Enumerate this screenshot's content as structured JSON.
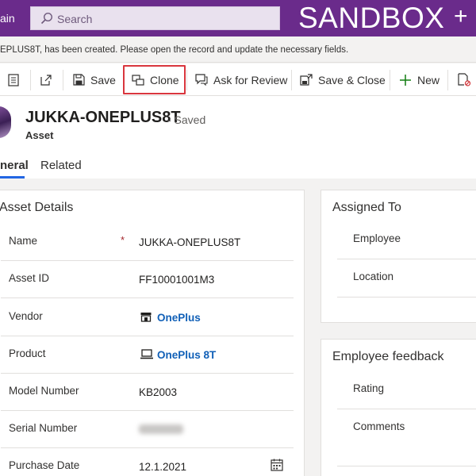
{
  "topbar": {
    "app_name": "ain",
    "search_placeholder": "Search",
    "environment": "SANDBOX",
    "accent": "#6a2b8b"
  },
  "notification": {
    "text": "EPLUS8T, has been created. Please open the record and update the necessary fields."
  },
  "commands": {
    "save": "Save",
    "clone": "Clone",
    "ask_for_review": "Ask for Review",
    "save_close": "Save & Close",
    "new": "New"
  },
  "record": {
    "title": "JUKKA-ONEPLUS8T",
    "status": "- Saved",
    "entity": "Asset"
  },
  "tabs": [
    "neral",
    "Related"
  ],
  "asset_details": {
    "title": "Asset Details",
    "fields": [
      {
        "label": "Name",
        "value": "JUKKA-ONEPLUS8T",
        "required": "*"
      },
      {
        "label": "Asset ID",
        "value": "FF10001001M3"
      },
      {
        "label": "Vendor",
        "value": "OnePlus"
      },
      {
        "label": "Product",
        "value": "OnePlus 8T"
      },
      {
        "label": "Model Number",
        "value": "KB2003"
      },
      {
        "label": "Serial Number",
        "value": ""
      },
      {
        "label": "Purchase Date",
        "value": "12.1.2021"
      }
    ]
  },
  "assigned_to": {
    "title": "Assigned To",
    "fields": [
      {
        "label": "Employee"
      },
      {
        "label": "Location"
      }
    ]
  },
  "employee_feedback": {
    "title": "Employee feedback",
    "fields": [
      {
        "label": "Rating"
      },
      {
        "label": "Comments"
      }
    ]
  }
}
